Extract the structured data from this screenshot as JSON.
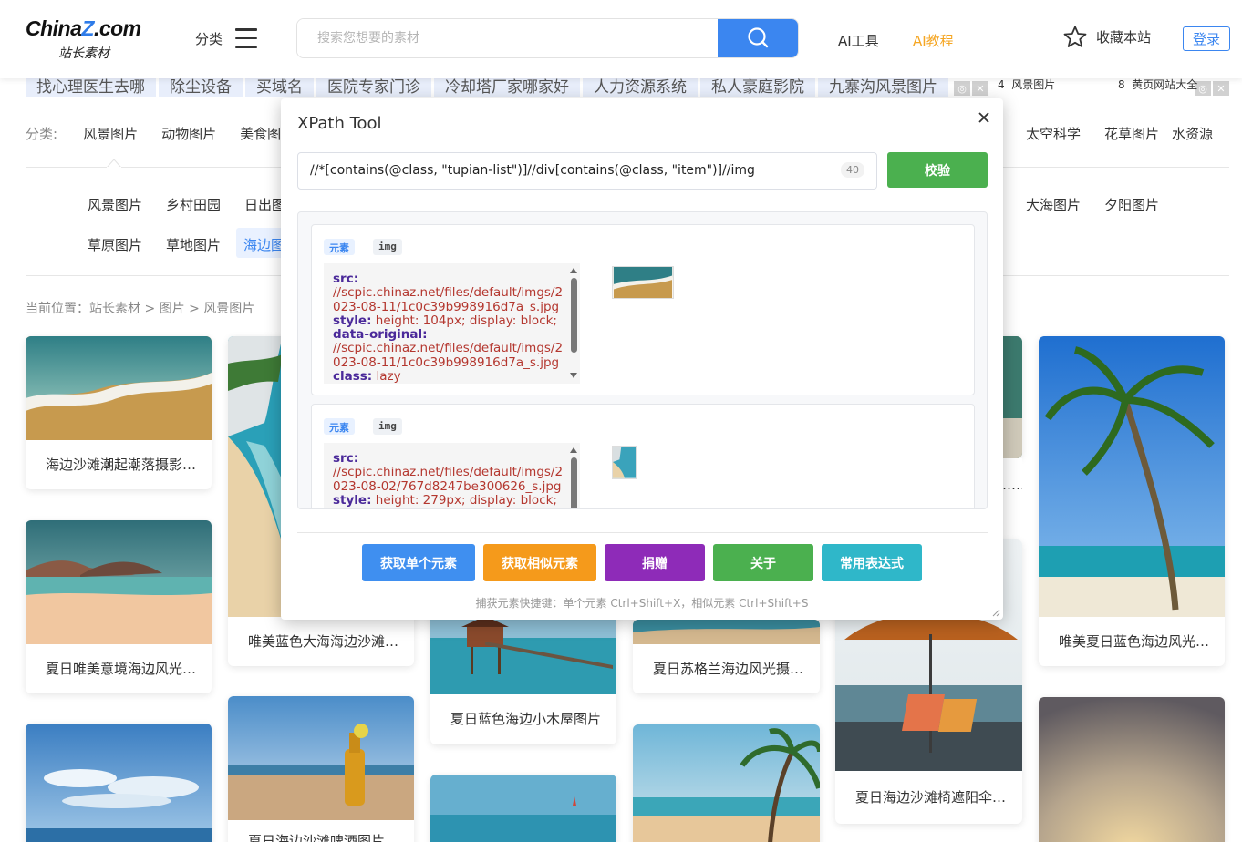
{
  "header": {
    "logo_main_prefix": "China",
    "logo_main_z": "Z",
    "logo_main_suffix": ".com",
    "logo_sub": "站长素材",
    "category_label": "分类",
    "search_placeholder": "搜索您想要的素材",
    "nav_ai_tools": "AI工具",
    "nav_ai_tutorial": "AI教程",
    "favorite": "收藏本站",
    "login": "登录",
    "accent": "#3b86f0",
    "highlight": "#f5a623"
  },
  "ads": {
    "items": [
      "找心理医生去哪",
      "除尘设备",
      "买域名",
      "医院专家门诊",
      "冷却塔厂家哪家好",
      "人力资源系统",
      "私人豪庭影院",
      "九寨沟风景图片"
    ],
    "numbered": [
      {
        "num": "4",
        "label": "风景图片"
      },
      {
        "num": "8",
        "label": "黄页网站大全"
      }
    ],
    "close_glyph": "✕"
  },
  "categories": {
    "label": "分类:",
    "items": [
      "风景图片",
      "动物图片",
      "美食图"
    ],
    "items_right": [
      "太空科学",
      "花草图片",
      "水资源"
    ]
  },
  "subcategories": {
    "row1_left": [
      "风景图片",
      "乡村田园",
      "日出图"
    ],
    "row1_right": [
      "大海图片",
      "夕阳图片"
    ],
    "row2_left": [
      "草原图片",
      "草地图片"
    ],
    "active": "海边图片"
  },
  "breadcrumb": "当前位置：站长素材 > 图片 > 风景图片",
  "cards": [
    {
      "caption": "海边沙滩潮起潮落摄影图片"
    },
    {
      "caption": "夏日唯美意境海边风光图片"
    },
    {
      "caption": "唯美蓝色大海海边沙滩图片"
    },
    {
      "caption": "夏日海边沙滩啤酒图片"
    },
    {
      "caption": "夏日蓝色海边小木屋图片"
    },
    {
      "caption": "夏日苏格兰海边风光摄影图片"
    },
    {
      "caption": "…"
    },
    {
      "caption": "夏日海边沙滩椅遮阳伞图片"
    },
    {
      "caption": "唯美夏日蓝色海边风光图片"
    }
  ],
  "xpath_tool": {
    "title": "XPath Tool",
    "xpath": "//*[contains(@class, \"tupian-list\")]//div[contains(@class, \"item\")]//img",
    "count": "40",
    "verify": "校验",
    "results": [
      {
        "tag_kind": "元素",
        "tag_name": "img",
        "attrs": [
          {
            "key": "src:",
            "value": "//scpic.chinaz.net/files/default/imgs/2023-08-11/1c0c39b998916d7a_s.jpg"
          },
          {
            "key": "style:",
            "value": "height: 104px; display: block;"
          },
          {
            "key": "data-original:",
            "value": "//scpic.chinaz.net/files/default/imgs/2023-08-11/1c0c39b998916d7a_s.jpg"
          },
          {
            "key": "class:",
            "value": "lazy"
          }
        ]
      },
      {
        "tag_kind": "元素",
        "tag_name": "img",
        "attrs": [
          {
            "key": "src:",
            "value": "//scpic.chinaz.net/files/default/imgs/2023-08-02/767d8247be300626_s.jpg"
          },
          {
            "key": "style:",
            "value": "height: 279px; display: block;"
          }
        ]
      }
    ],
    "buttons": [
      {
        "label": "获取单个元素",
        "color": "#3f8ff0"
      },
      {
        "label": "获取相似元素",
        "color": "#f59a1b"
      },
      {
        "label": "捐赠",
        "color": "#8e2bb8"
      },
      {
        "label": "关于",
        "color": "#4bb04f"
      },
      {
        "label": "常用表达式",
        "color": "#2fb7c9"
      }
    ],
    "hint": "捕获元素快捷键：单个元素 Ctrl+Shift+X，相似元素 Ctrl+Shift+S"
  }
}
